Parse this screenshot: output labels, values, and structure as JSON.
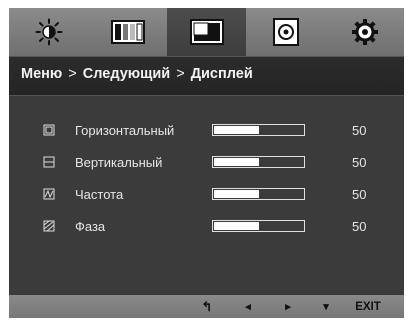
{
  "tabs": [
    {
      "name": "brightness-icon",
      "active": false
    },
    {
      "name": "contrast-icon",
      "active": false
    },
    {
      "name": "display-icon",
      "active": true
    },
    {
      "name": "color-icon",
      "active": false
    },
    {
      "name": "settings-icon",
      "active": false
    }
  ],
  "breadcrumb": {
    "root": "Меню",
    "separator": ">",
    "middle": "Следующий",
    "current": "Дисплей"
  },
  "settings": [
    {
      "label": "Горизонтальный",
      "value": "50",
      "level": 0.5,
      "icon": "horizontal-position-icon"
    },
    {
      "label": "Вертикальный",
      "value": "50",
      "level": 0.5,
      "icon": "vertical-position-icon"
    },
    {
      "label": "Частота",
      "value": "50",
      "level": 0.5,
      "icon": "clock-icon"
    },
    {
      "label": "Фаза",
      "value": "50",
      "level": 0.5,
      "icon": "phase-icon"
    }
  ],
  "bottom_bar": {
    "buttons": [
      {
        "name": "return-button",
        "symbol": "↰"
      },
      {
        "name": "left-button",
        "symbol": "◂"
      },
      {
        "name": "right-button",
        "symbol": "▸"
      },
      {
        "name": "down-button",
        "symbol": "▾"
      }
    ],
    "exit_label": "EXIT"
  },
  "colors": {
    "panel": "#3b3b3c",
    "tabbar": "#7d7d7e",
    "text": "#e6e6e6",
    "bar_fill": "#ffffff"
  }
}
